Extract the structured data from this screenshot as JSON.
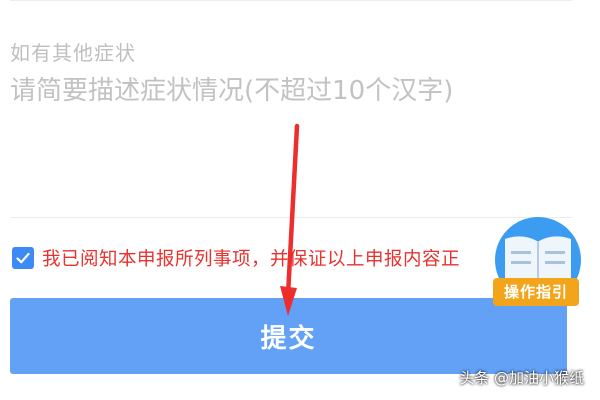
{
  "form": {
    "other_symptoms_label": "如有其他症状",
    "symptom_placeholder": "请简要描述症状情况(不超过10个汉字)",
    "symptom_value": ""
  },
  "consent": {
    "checked": true,
    "text": "我已阅知本申报所列事项，并保证以上申报内容正"
  },
  "submit": {
    "label": "提交"
  },
  "guide": {
    "label": "操作指引",
    "icon": "open-book-icon"
  },
  "annotation": {
    "arrow_color": "#ee2d2d"
  },
  "watermark": {
    "text": "头条 @加油小猴纸"
  },
  "colors": {
    "primary": "#63a1f7",
    "checkbox": "#3d8af7",
    "consent_text": "#e8322e",
    "guide_circle": "#3c9cf2",
    "guide_label": "#f2a41a"
  }
}
